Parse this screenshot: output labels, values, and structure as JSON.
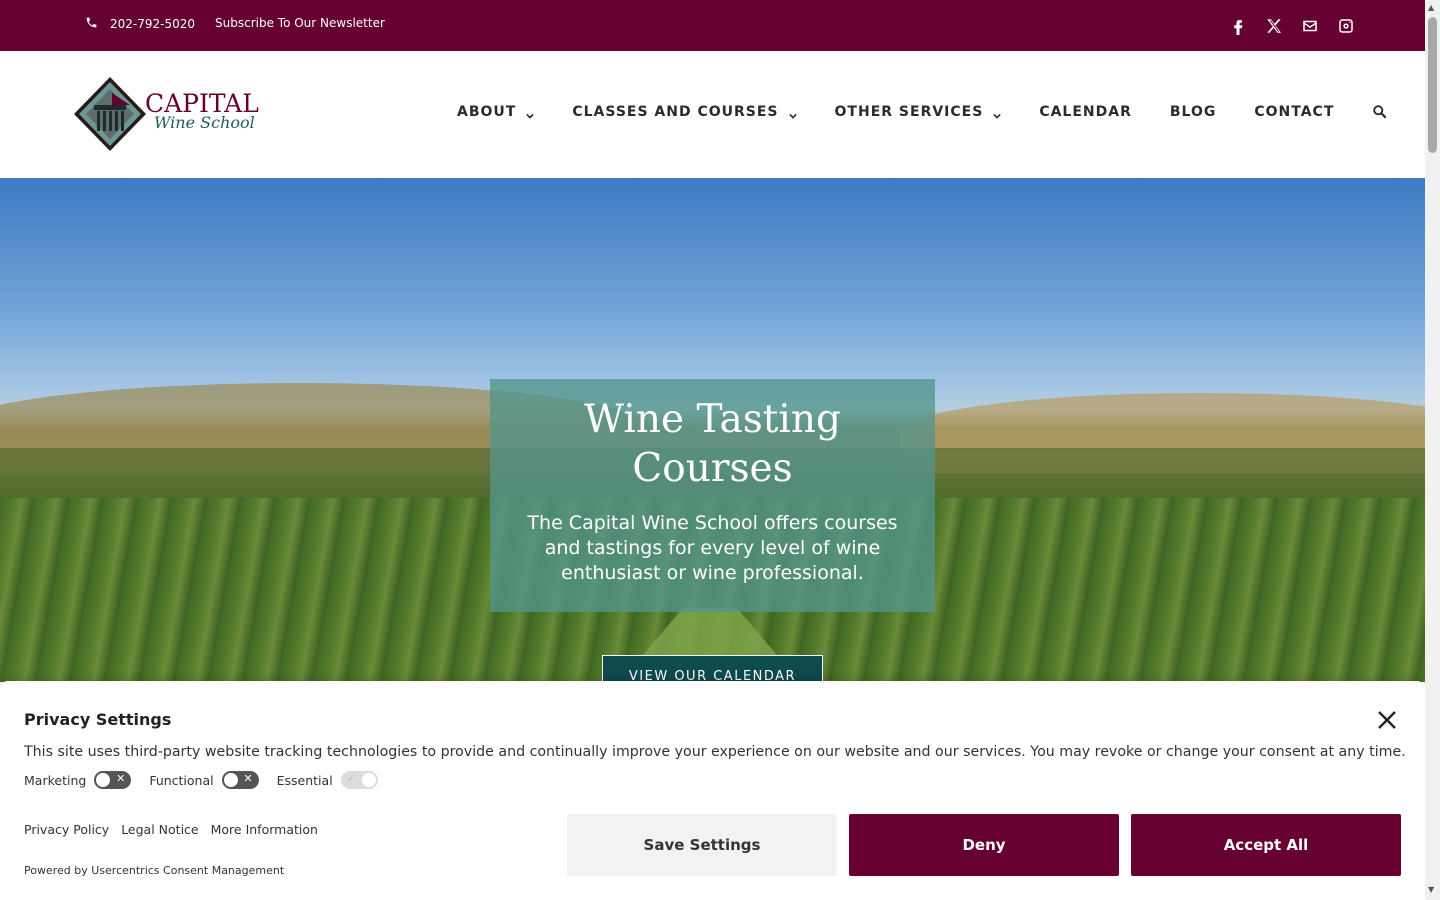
{
  "topbar": {
    "phone": "202-792-5020",
    "newsletter": "Subscribe To Our Newsletter",
    "social": [
      "facebook-icon",
      "x-twitter-icon",
      "mail-icon",
      "instagram-icon"
    ]
  },
  "logo": {
    "line1": "CAPITAL",
    "line2": "Wine School"
  },
  "nav": {
    "items": [
      {
        "label": "ABOUT",
        "has_dropdown": true
      },
      {
        "label": "CLASSES AND COURSES",
        "has_dropdown": true
      },
      {
        "label": "OTHER SERVICES",
        "has_dropdown": true
      },
      {
        "label": "CALENDAR",
        "has_dropdown": false
      },
      {
        "label": "BLOG",
        "has_dropdown": false
      },
      {
        "label": "CONTACT",
        "has_dropdown": false
      }
    ],
    "search_icon": "search-icon"
  },
  "hero": {
    "title_line1": "Wine Tasting",
    "title_line2": "Courses",
    "subtitle": "The Capital Wine School offers courses and tastings for every level of wine enthusiast or wine professional.",
    "button": "VIEW OUR CALENDAR"
  },
  "privacy": {
    "title": "Privacy Settings",
    "text": "This site uses third-party website tracking technologies to provide and continually improve your experience on our website and our services. You may revoke or change your consent at any time.",
    "toggles": [
      {
        "label": "Marketing",
        "on": false
      },
      {
        "label": "Functional",
        "on": false
      },
      {
        "label": "Essential",
        "on": true
      }
    ],
    "links": [
      "Privacy Policy",
      "Legal Notice",
      "More Information"
    ],
    "powered": "Powered by Usercentrics Consent Management",
    "save": "Save Settings",
    "deny": "Deny",
    "accept": "Accept All"
  },
  "colors": {
    "brand": "#650031",
    "teal": "#1d5d5a",
    "hero_box": "#53958c"
  }
}
